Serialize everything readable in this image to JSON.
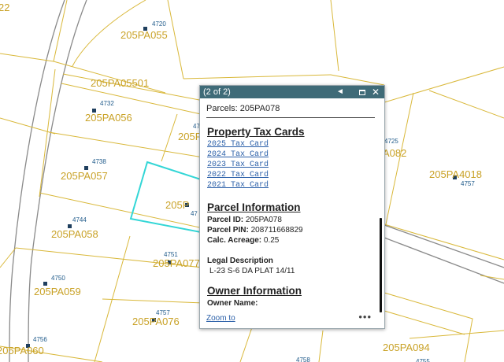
{
  "map": {
    "parcels": [
      "22",
      "205PA055",
      "205PA05501",
      "205PA056",
      "205PA057",
      "205PA058",
      "205PA059",
      "205PA060",
      "205PA077",
      "205PA076",
      "205PA094",
      "205PA4018",
      "A082",
      "205P",
      "205P"
    ],
    "addresses": [
      "4720",
      "4732",
      "4738",
      "4744",
      "4750",
      "4756",
      "4751",
      "4757",
      "4725",
      "4757",
      "4758",
      "4755",
      "47",
      "47"
    ],
    "colors": {
      "parcel_line": "#d9b83a",
      "selected": "#33d6d6",
      "road": "#8a8a8a",
      "address": "#1f5a8a"
    }
  },
  "popup": {
    "counter": "(2 of 2)",
    "prev_icon": "◄",
    "close_icon": "✕",
    "title": "Parcels: 205PA078",
    "tax_section": "Property Tax Cards",
    "tax_cards": [
      "2025 Tax Card",
      "2024 Tax Card",
      "2023 Tax Card",
      "2022 Tax Card",
      "2021 Tax Card"
    ],
    "parcel_section": "Parcel Information",
    "parcel_id_label": "Parcel ID:",
    "parcel_id": " 205PA078",
    "pin_label": "Parcel PIN:",
    "pin": " 208711668829",
    "acreage_label": "Calc. Acreage:",
    "acreage": " 0.25",
    "legal_label": "Legal Description",
    "legal": "L-23 S-6 DA PLAT 14/11",
    "owner_section": "Owner Information",
    "owner_label": "Owner Name:",
    "zoom": "Zoom to",
    "more": "•••"
  }
}
